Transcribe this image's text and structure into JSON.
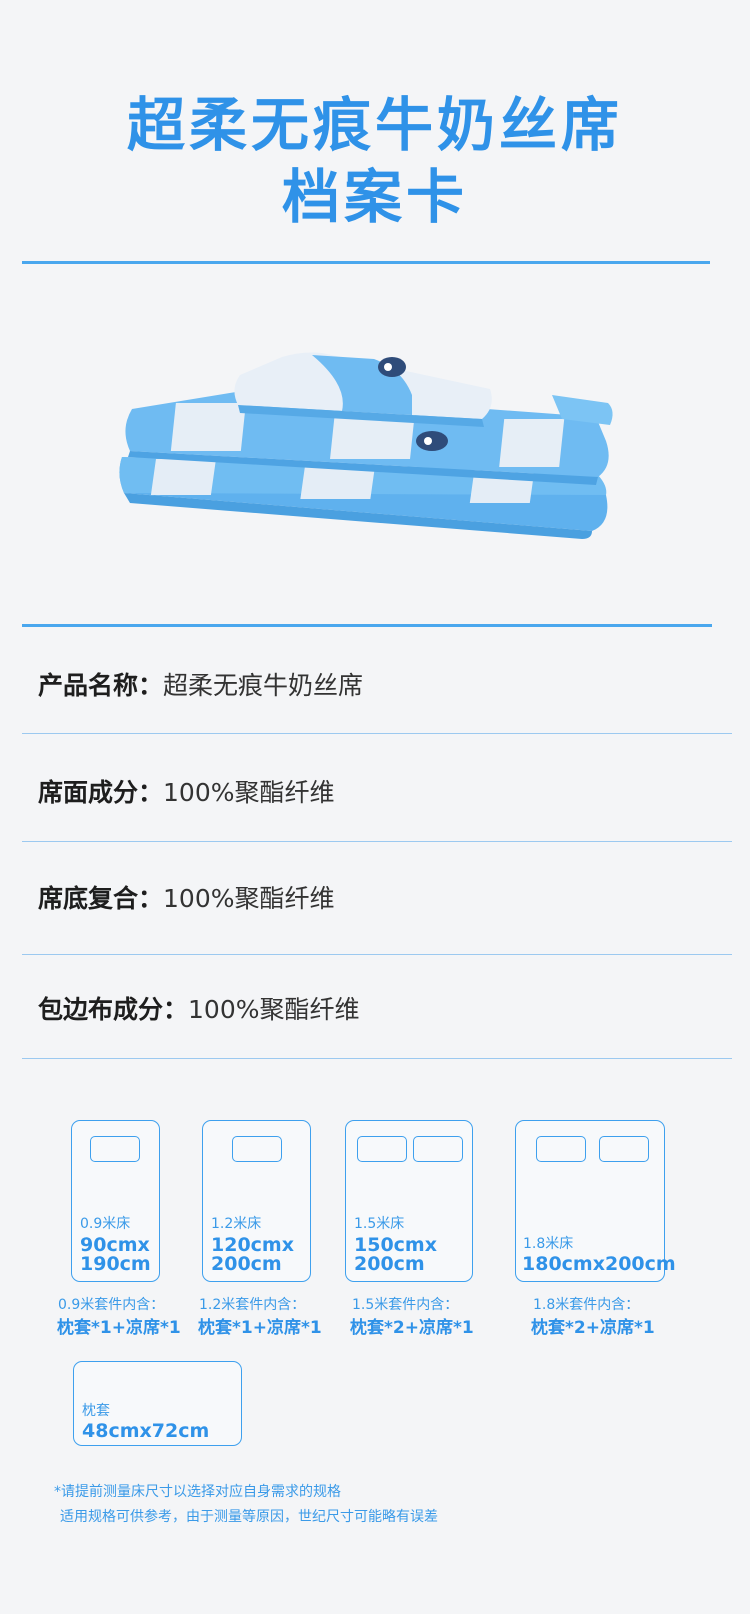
{
  "title": {
    "line1": "超柔无痕牛奶丝席",
    "line2": "档案卡"
  },
  "specs": [
    {
      "key": "产品名称：",
      "value": "超柔无痕牛奶丝席"
    },
    {
      "key": "席面成分：",
      "value": "100%聚酯纤维"
    },
    {
      "key": "席底复合：",
      "value": "100%聚酯纤维"
    },
    {
      "key": "包边布成分：",
      "value": "100%聚酯纤维"
    }
  ],
  "beds": [
    {
      "label": "0.9米床",
      "size_line1": "90cmx",
      "size_line2": "190cm",
      "set_label": "0.9米套件内含：",
      "set_content": "枕套*1+凉席*1"
    },
    {
      "label": "1.2米床",
      "size_line1": "120cmx",
      "size_line2": "200cm",
      "set_label": "1.2米套件内含：",
      "set_content": "枕套*1+凉席*1"
    },
    {
      "label": "1.5米床",
      "size_line1": "150cmx",
      "size_line2": "200cm",
      "set_label": "1.5米套件内含：",
      "set_content": "枕套*2+凉席*1"
    },
    {
      "label": "1.8米床",
      "size_line1": "180cmx200cm",
      "set_label": "1.8米套件内含：",
      "set_content": "枕套*2+凉席*1"
    }
  ],
  "pillowcase": {
    "label": "枕套",
    "size": "48cmx72cm"
  },
  "notes": {
    "line1": "*请提前测量床尺寸以选择对应自身需求的规格",
    "line2": "适用规格可供参考，由于测量等原因，世纪尺寸可能略有误差"
  },
  "colors": {
    "accent": "#2f92e8",
    "line": "#4aa7ee",
    "background": "#f4f5f7",
    "sheet_blue": "#66b7f0",
    "sheet_white": "#e6eef6"
  },
  "icons": [
    "folded-mat-image",
    "pillow-icon"
  ]
}
